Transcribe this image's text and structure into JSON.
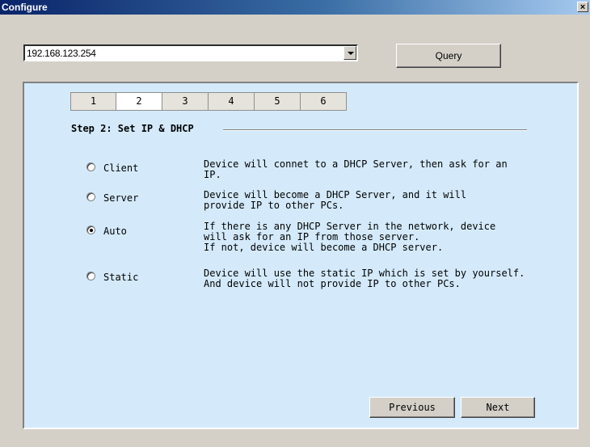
{
  "window": {
    "title": "Configure",
    "close_label": "×"
  },
  "device": {
    "ip": "192.168.123.254",
    "query_label": "Query"
  },
  "tabs": [
    "1",
    "2",
    "3",
    "4",
    "5",
    "6"
  ],
  "active_tab": "2",
  "step": {
    "title": "Step 2: Set IP & DHCP"
  },
  "options": [
    {
      "label": "Client",
      "checked": false,
      "desc": "Device will connet to a DHCP Server, then ask for an\nIP."
    },
    {
      "label": "Server",
      "checked": false,
      "desc": "Device will become a DHCP Server, and it will\nprovide IP to other PCs."
    },
    {
      "label": "Auto",
      "checked": true,
      "desc": "If there is any DHCP Server in the network, device\nwill ask for an IP from those server.\nIf not, device will become a DHCP server."
    },
    {
      "label": "Static",
      "checked": false,
      "desc": "Device will use the static IP which is set by yourself.\nAnd device will not provide IP to other PCs."
    }
  ],
  "nav": {
    "previous_label": "Previous",
    "next_label": "Next"
  }
}
